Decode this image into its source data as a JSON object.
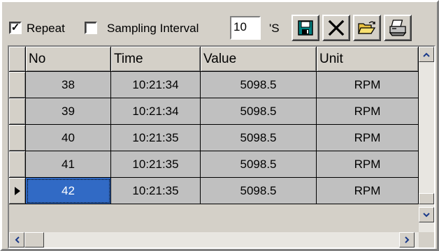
{
  "toolbar": {
    "repeat_label": "Repeat",
    "repeat_checked": true,
    "sampling_checked": false,
    "sampling_label": "Sampling Interval",
    "interval_value": "10",
    "interval_unit": "'S",
    "save_icon": "floppy-disk-icon",
    "clear_icon": "x-delete-icon",
    "open_icon": "open-folder-icon",
    "print_icon": "printer-icon"
  },
  "grid": {
    "columns": [
      "No",
      "Time",
      "Value",
      "Unit"
    ],
    "rows": [
      {
        "no": "38",
        "time": "10:21:34",
        "value": "5098.5",
        "unit": "RPM"
      },
      {
        "no": "39",
        "time": "10:21:34",
        "value": "5098.5",
        "unit": "RPM"
      },
      {
        "no": "40",
        "time": "10:21:35",
        "value": "5098.5",
        "unit": "RPM"
      },
      {
        "no": "41",
        "time": "10:21:35",
        "value": "5098.5",
        "unit": "RPM"
      },
      {
        "no": "42",
        "time": "10:21:35",
        "value": "5098.5",
        "unit": "RPM"
      }
    ],
    "selected_row": 4
  },
  "colors": {
    "selection": "#316ac5",
    "face": "#d4d0c8",
    "cell": "#c0c0c0"
  }
}
